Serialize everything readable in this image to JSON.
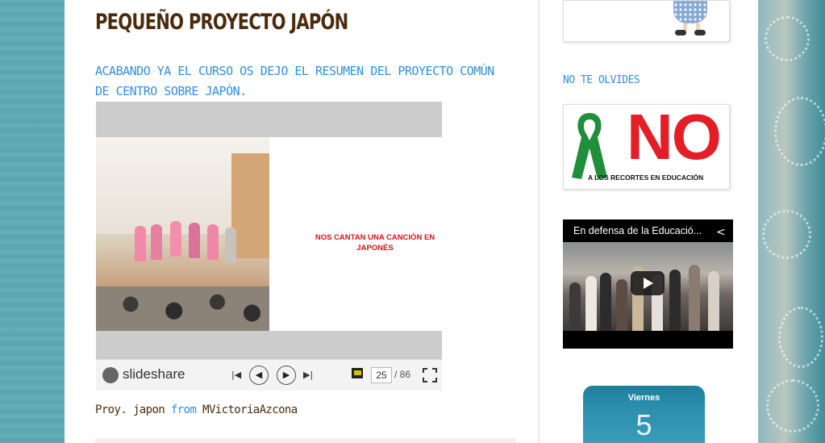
{
  "post": {
    "title": "PEQUEÑO PROYECTO JAPÓN",
    "intro": "ACABANDO YA EL CURSO OS DEJO EL RESUMEN DEL PROYECTO COMÚN DE CENTRO SOBRE JAPÓN.",
    "embed_credit_title": "Proy. japon",
    "embed_credit_from": "from",
    "embed_credit_author": "MVictoriaAzcona"
  },
  "slideshare": {
    "slide_caption": "NOS CANTAN UNA CANCIÓN EN JAPONÉS",
    "brand_name": "slideshare",
    "current_page": "25",
    "total_pages": "/ 86",
    "icons": [
      "slideshare-logo-icon",
      "first-slide-icon",
      "prev-slide-icon",
      "next-slide-icon",
      "last-slide-icon",
      "flag-icon",
      "fullscreen-icon"
    ]
  },
  "sidebar": {
    "widget_title": "NO TE OLVIDES",
    "banner_no": "NO",
    "banner_sub": "A LOS RECORTES EN EDUCACIÓN",
    "video_title": "En defensa de la Educació...",
    "calendar_day": "Viernes",
    "calendar_num": "5"
  },
  "colors": {
    "title_brown": "#4a2b0c",
    "link_blue": "#2f8fe0",
    "no_red": "#e41e26",
    "ribbon_green": "#1f8f3a",
    "calendar_teal": "#2b8fad"
  }
}
